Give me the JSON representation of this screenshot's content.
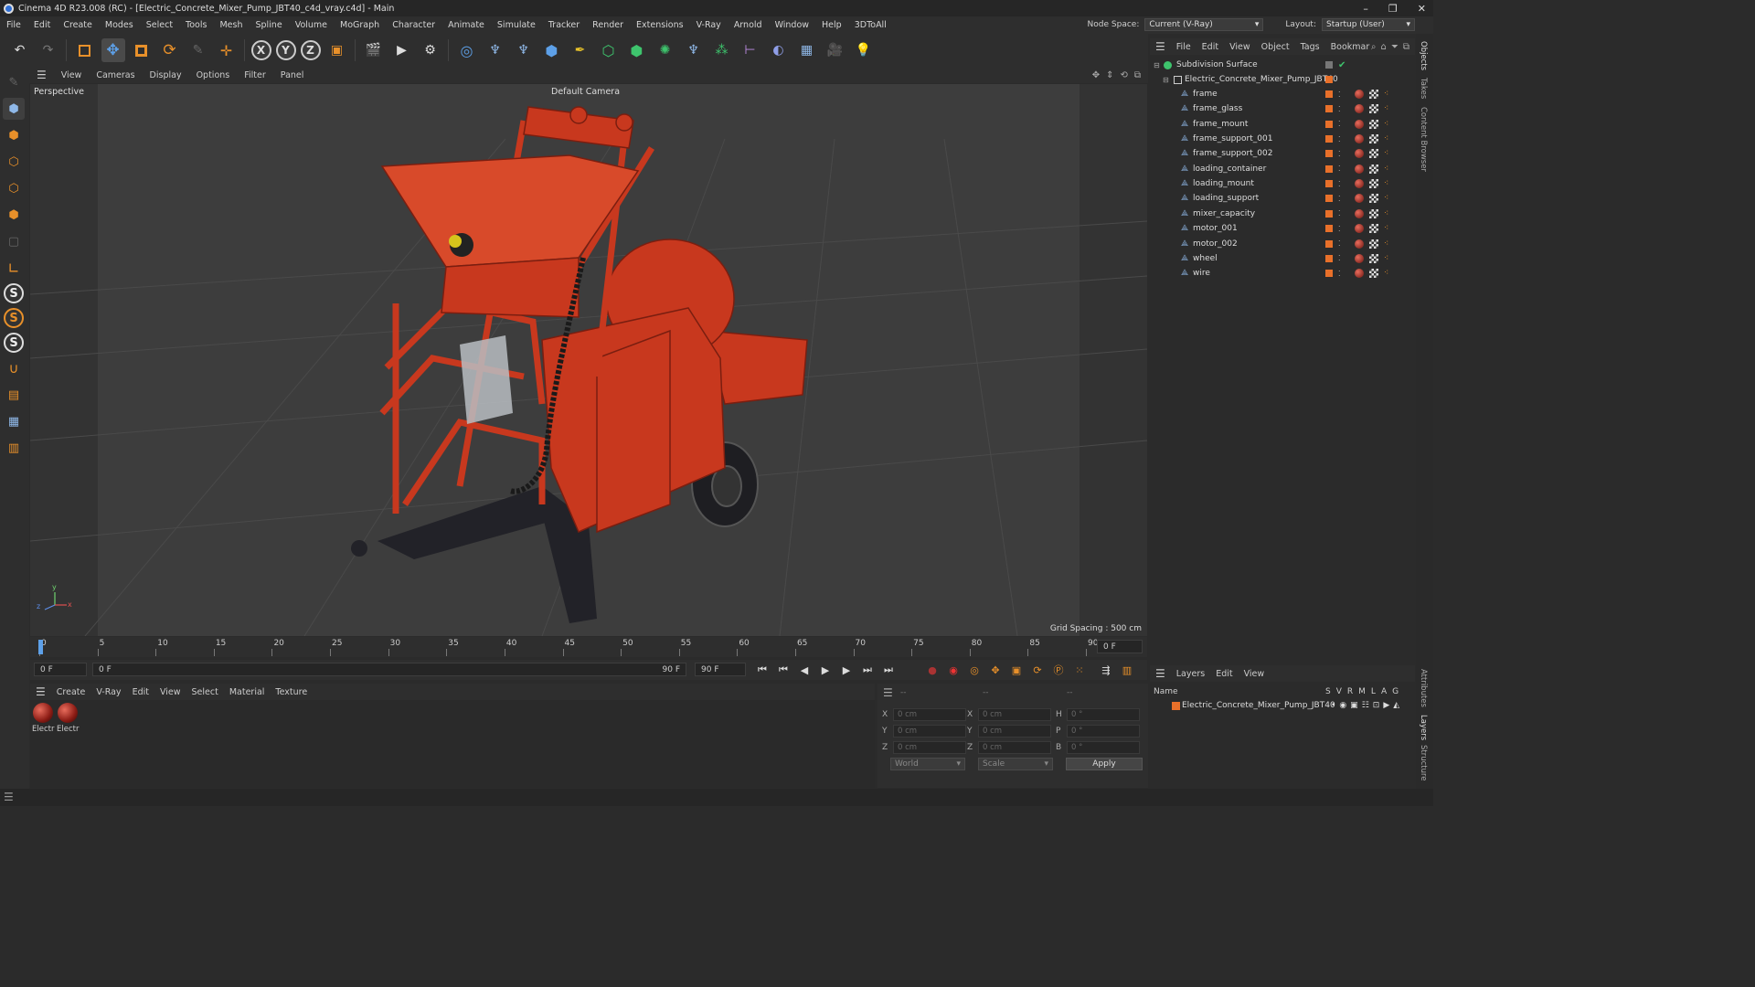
{
  "window": {
    "title": "Cinema 4D R23.008 (RC) - [Electric_Concrete_Mixer_Pump_JBT40_c4d_vray.c4d] - Main",
    "minimize": "–",
    "restore": "❐",
    "close": "✕"
  },
  "menu": {
    "items": [
      "File",
      "Edit",
      "Create",
      "Modes",
      "Select",
      "Tools",
      "Mesh",
      "Spline",
      "Volume",
      "MoGraph",
      "Character",
      "Animate",
      "Simulate",
      "Tracker",
      "Render",
      "Extensions",
      "V-Ray",
      "Arnold",
      "Window",
      "Help",
      "3DToAll"
    ],
    "node_space_label": "Node Space:",
    "node_space_value": "Current (V-Ray)",
    "layout_label": "Layout:",
    "layout_value": "Startup (User)"
  },
  "toolbar": {
    "undo": "↶",
    "redo": "↷",
    "axis_x": "X",
    "axis_y": "Y",
    "axis_z": "Z"
  },
  "viewport": {
    "menu": [
      "View",
      "Cameras",
      "Display",
      "Options",
      "Filter",
      "Panel"
    ],
    "label": "Perspective",
    "camera": "Default Camera",
    "grid_spacing": "Grid Spacing : 500 cm"
  },
  "timeline": {
    "ticks": [
      "0",
      "5",
      "10",
      "15",
      "20",
      "25",
      "30",
      "35",
      "40",
      "45",
      "50",
      "55",
      "60",
      "65",
      "70",
      "75",
      "80",
      "85",
      "90"
    ],
    "current_frame_field": "0 F",
    "start_field": "0 F",
    "range_start": "0 F",
    "range_end": "90 F",
    "end_field": "90 F"
  },
  "material_panel": {
    "menu": [
      "Create",
      "V-Ray",
      "Edit",
      "View",
      "Select",
      "Material",
      "Texture"
    ],
    "materials": [
      "Electr",
      "Electr"
    ]
  },
  "coordinates": {
    "header_a": "--",
    "header_b": "--",
    "header_c": "--",
    "x_pos": "0 cm",
    "y_pos": "0 cm",
    "z_pos": "0 cm",
    "x_size": "0 cm",
    "y_size": "0 cm",
    "z_size": "0 cm",
    "h": "0 °",
    "p": "0 °",
    "b": "0 °",
    "labels": {
      "x": "X",
      "y": "Y",
      "z": "Z",
      "h": "H",
      "p": "P",
      "b": "B"
    },
    "mode_world": "World",
    "mode_scale": "Scale",
    "apply": "Apply"
  },
  "object_manager": {
    "menu": [
      "File",
      "Edit",
      "View",
      "Object",
      "Tags",
      "Bookmar"
    ],
    "root": "Subdivision Surface",
    "group": "Electric_Concrete_Mixer_Pump_JBT40",
    "children": [
      "frame",
      "frame_glass",
      "frame_mount",
      "frame_support_001",
      "frame_support_002",
      "loading_container",
      "loading_mount",
      "loading_support",
      "mixer_capacity",
      "motor_001",
      "motor_002",
      "wheel",
      "wire"
    ]
  },
  "layers": {
    "menu": [
      "Layers",
      "Edit",
      "View"
    ],
    "col_name": "Name",
    "cols": [
      "S",
      "V",
      "R",
      "M",
      "L",
      "A",
      "G"
    ],
    "row": "Electric_Concrete_Mixer_Pump_JBT40"
  },
  "right_tabs": [
    "Objects",
    "Takes",
    "Content Browser",
    "Attributes",
    "Layers",
    "Structure"
  ],
  "colors": {
    "accent_orange": "#e8702a",
    "machine_red": "#c23a20",
    "viewport_bg": "#3d3d3d"
  }
}
